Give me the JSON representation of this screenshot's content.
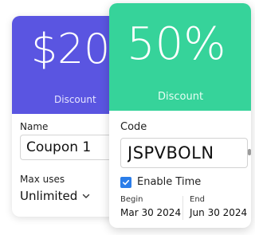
{
  "back_card": {
    "amount": "$20",
    "hero_label": "Discount",
    "hero_color": "#5a55e1",
    "name_label": "Name",
    "name_value": "Coupon 1",
    "max_uses_label": "Max uses",
    "max_uses_value": "Unlimited",
    "max_uses_icon": "chevron-down-icon"
  },
  "front_card": {
    "percent": "50%",
    "hero_label": "Discount",
    "hero_color": "#36d39a",
    "code_label": "Code",
    "code_value": "JSPVBOLN",
    "enable_time_label": "Enable Time",
    "enable_time_checked": true,
    "checkbox_color": "#2b7de9",
    "begin_label": "Begin",
    "begin_value": "Mar 30 2024",
    "end_label": "End",
    "end_value": "Jun 30 2024"
  }
}
